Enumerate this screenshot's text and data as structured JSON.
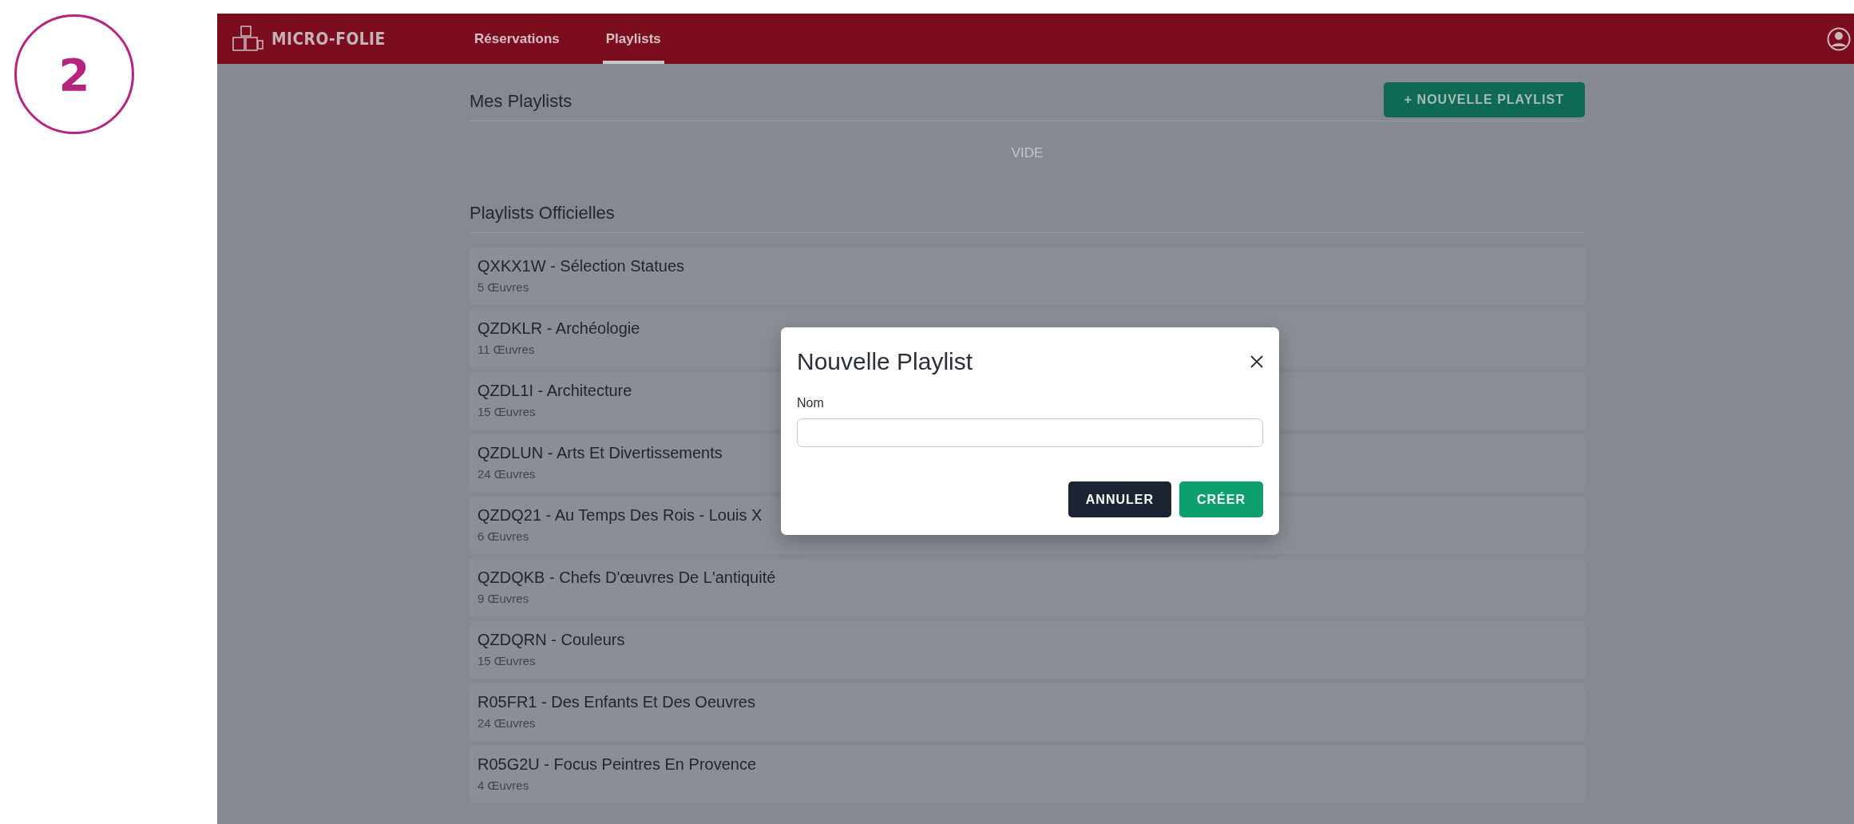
{
  "step": "2",
  "header": {
    "logo": "MICRO-FOLIE",
    "tabs": [
      {
        "label": "Réservations",
        "selected": false
      },
      {
        "label": "Playlists",
        "selected": true
      }
    ]
  },
  "my_playlists": {
    "title": "Mes Playlists",
    "new_button": "+ NOUVELLE PLAYLIST",
    "empty": "VIDE"
  },
  "official_playlists": {
    "title": "Playlists Officielles",
    "items": [
      {
        "name": "QXKX1W - Sélection Statues",
        "count": "5 Œuvres"
      },
      {
        "name": "QZDKLR - Archéologie",
        "count": "11 Œuvres"
      },
      {
        "name": "QZDL1I - Architecture",
        "count": "15 Œuvres"
      },
      {
        "name": "QZDLUN - Arts Et Divertissements",
        "count": "24 Œuvres"
      },
      {
        "name": "QZDQ21 - Au Temps Des Rois - Louis X",
        "count": "6 Œuvres"
      },
      {
        "name": "QZDQKB - Chefs D'œuvres De L'antiquité",
        "count": "9 Œuvres"
      },
      {
        "name": "QZDQRN - Couleurs",
        "count": "15 Œuvres"
      },
      {
        "name": "R05FR1 - Des Enfants Et Des Oeuvres",
        "count": "24 Œuvres"
      },
      {
        "name": "R05G2U - Focus Peintres En Provence",
        "count": "4 Œuvres"
      }
    ]
  },
  "dialog": {
    "title": "Nouvelle Playlist",
    "field": {
      "label": "Nom"
    },
    "buttons": [
      {
        "label": "ANNULER",
        "kind": "secondary"
      },
      {
        "label": "CRÉER",
        "kind": "primary"
      }
    ]
  }
}
